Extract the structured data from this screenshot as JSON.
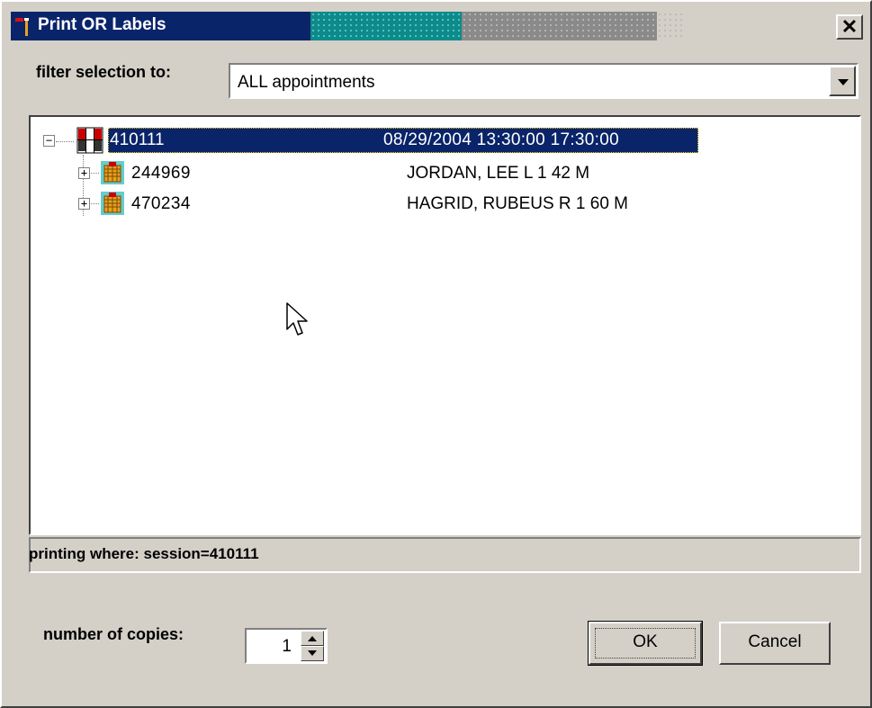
{
  "window": {
    "title": "Print OR Labels",
    "close_glyph": "✕",
    "colors": {
      "titlebar": "#0a246a",
      "face": "#d4d0c8",
      "selection": "#0a246a"
    }
  },
  "filter": {
    "label": "filter selection to:",
    "selected": "ALL appointments"
  },
  "tree": {
    "root": {
      "id": "410111",
      "datetime": "08/29/2004  13:30:00   17:30:00",
      "expander": "−",
      "icon": "calendar-grid-icon"
    },
    "children": [
      {
        "id": "244969",
        "name": "JORDAN, LEE  L 1 42 M",
        "expander": "+",
        "icon": "patient-basket-icon"
      },
      {
        "id": "470234",
        "name": "HAGRID, RUBEUS  R 1 60 M",
        "expander": "+",
        "icon": "patient-basket-icon"
      }
    ]
  },
  "status": {
    "text": "printing where: session=410111"
  },
  "copies": {
    "label": "number of copies:",
    "value": "1"
  },
  "buttons": {
    "ok": "OK",
    "cancel": "Cancel"
  }
}
